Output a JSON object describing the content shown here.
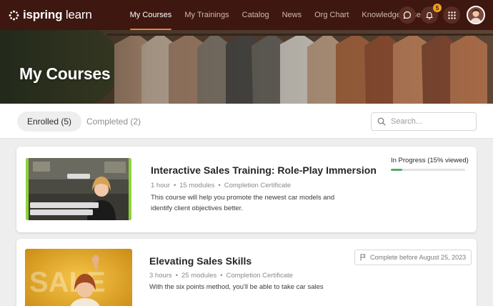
{
  "brand": {
    "name_bold": "ispring",
    "name_light": "learn"
  },
  "nav": {
    "items": [
      {
        "label": "My Courses",
        "active": true
      },
      {
        "label": "My Trainings",
        "active": false
      },
      {
        "label": "Catalog",
        "active": false
      },
      {
        "label": "News",
        "active": false
      },
      {
        "label": "Org Chart",
        "active": false
      },
      {
        "label": "Knowledge Base",
        "active": false
      }
    ]
  },
  "header_icons": {
    "chat": "chat-icon",
    "notifications": "bell-icon",
    "notification_count": "5",
    "apps": "grid-icon",
    "avatar": "user-avatar"
  },
  "hero": {
    "title": "My Courses"
  },
  "tabs": [
    {
      "label": "Enrolled (5)",
      "active": true
    },
    {
      "label": "Completed (2)",
      "active": false
    }
  ],
  "search": {
    "placeholder": "Search...",
    "value": ""
  },
  "courses": [
    {
      "title": "Interactive Sales Training: Role-Play Immersion",
      "duration": "1 hour",
      "modules": "15 modules",
      "certificate": "Completion Certificate",
      "description": "This course will help you promote the newest car models and identify client objectives better.",
      "status": "In Progress (15% viewed)",
      "progress": 0.15
    },
    {
      "title": "Elevating Sales Skills",
      "duration": "3 hours",
      "modules": "25 modules",
      "certificate": "Completion Certificate",
      "description": "With the six points method, you'll be able to take car sales",
      "deadline": "Complete before August 25, 2023",
      "thumbnail_text": "SALE"
    }
  ],
  "colors": {
    "topbar": "#3d1710",
    "accent": "#e8823c",
    "badge": "#f0a21a",
    "progress": "#4caf68"
  }
}
